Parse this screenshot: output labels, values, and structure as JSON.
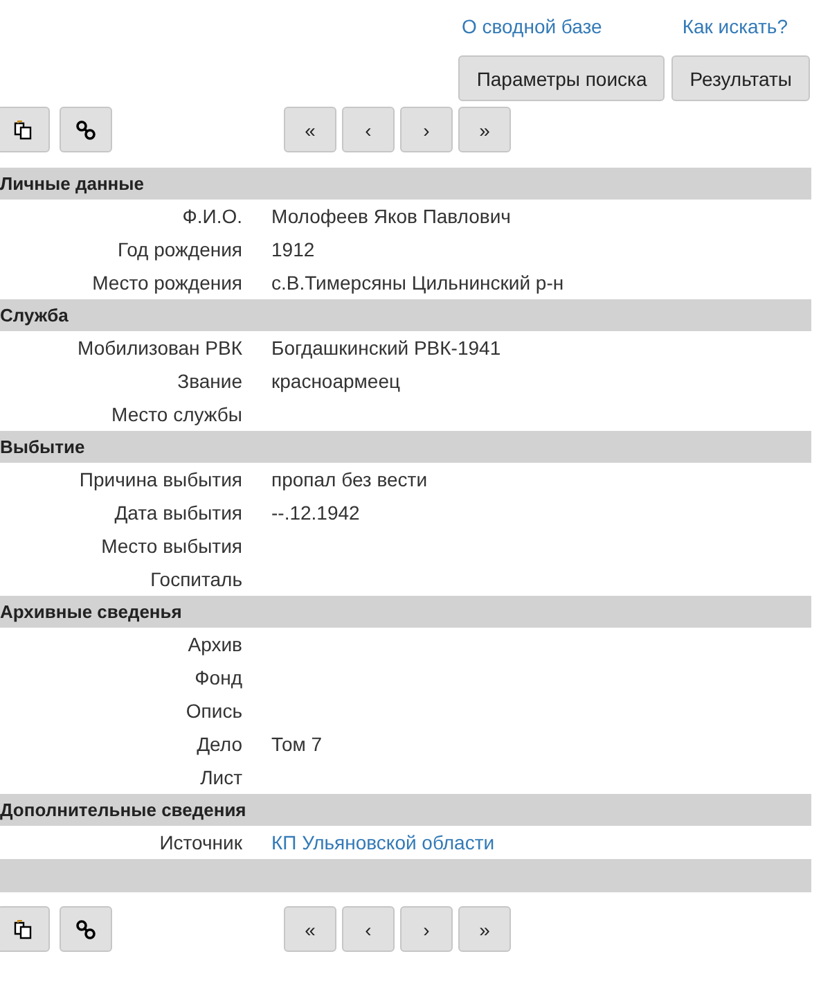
{
  "header_links": [
    "О сводной базе",
    "Как искать?"
  ],
  "header_buttons": [
    "Параметры поиска",
    "Результаты"
  ],
  "toolbars": [
    {
      "nav": [
        "«",
        "‹",
        "›",
        "»"
      ]
    },
    {
      "nav": [
        "«",
        "‹",
        "›",
        "»"
      ]
    }
  ],
  "sections": [
    {
      "title": "Личные данные",
      "rows": [
        {
          "label": "Ф.И.О.",
          "value": "Молофеев Яков Павлович",
          "kind": "text"
        },
        {
          "label": "Год рождения",
          "value": "1912",
          "kind": "text"
        },
        {
          "label": "Место рождения",
          "value": "с.В.Тимерсяны Цильнинский р-н",
          "kind": "text"
        }
      ]
    },
    {
      "title": "Служба",
      "rows": [
        {
          "label": "Мобилизован РВК",
          "value": "Богдашкинский РВК-1941",
          "kind": "text"
        },
        {
          "label": "Звание",
          "value": "красноармеец",
          "kind": "text"
        },
        {
          "label": "Место службы"
        }
      ]
    },
    {
      "title": "Выбытие",
      "rows": [
        {
          "label": "Причина выбытия",
          "value": "пропал без вести",
          "kind": "text"
        },
        {
          "label": "Дата выбытия",
          "value": "--.12.1942",
          "kind": "text"
        },
        {
          "label": "Место выбытия"
        },
        {
          "label": "Госпиталь"
        }
      ]
    },
    {
      "title": "Архивные сведенья",
      "rows": [
        {
          "label": "Архив"
        },
        {
          "label": "Фонд"
        },
        {
          "label": "Опись"
        },
        {
          "label": "Дело",
          "value": "Том 7",
          "kind": "text"
        },
        {
          "label": "Лист"
        }
      ]
    },
    {
      "title": "Дополнительные сведения",
      "rows": [
        {
          "label": "Источник",
          "value": "КП Ульяновской области",
          "kind": "link"
        }
      ]
    }
  ]
}
